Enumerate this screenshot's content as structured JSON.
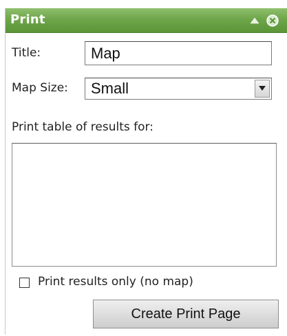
{
  "panel": {
    "title": "Print",
    "icons": [
      "collapse-icon",
      "close-icon"
    ],
    "accent_color": "#6fa64b"
  },
  "form": {
    "title_label": "Title:",
    "title_value": "Map",
    "map_size_label": "Map Size:",
    "map_size_value": "Small",
    "table_label": "Print table of results for:",
    "results_only_label": "Print results only (no map)",
    "results_only_checked": false,
    "create_button_label": "Create Print Page"
  }
}
